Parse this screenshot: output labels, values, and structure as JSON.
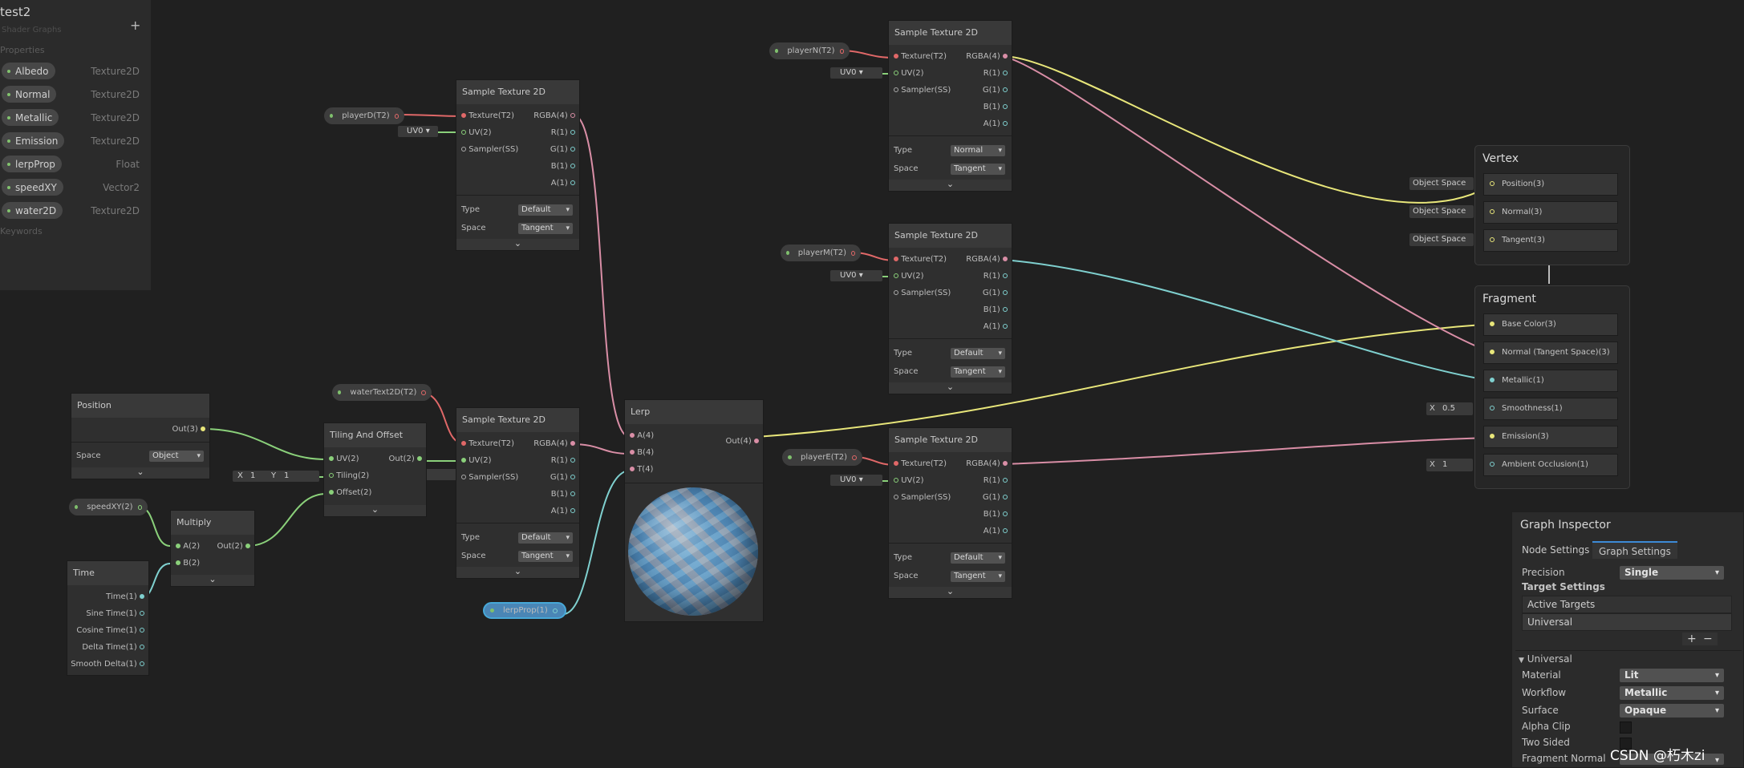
{
  "blackboard": {
    "title": "test2",
    "subtitle": "Shader Graphs",
    "add_glyph": "+",
    "properties_label": "Properties",
    "keywords_label": "Keywords",
    "properties": [
      {
        "name": "Albedo",
        "type": "Texture2D"
      },
      {
        "name": "Normal",
        "type": "Texture2D"
      },
      {
        "name": "Metallic",
        "type": "Texture2D"
      },
      {
        "name": "Emission",
        "type": "Texture2D"
      },
      {
        "name": "lerpProp",
        "type": "Float"
      },
      {
        "name": "speedXY",
        "type": "Vector2"
      },
      {
        "name": "water2D",
        "type": "Texture2D"
      }
    ]
  },
  "sample": {
    "title": "Sample Texture 2D",
    "inputs": [
      "Texture(T2)",
      "UV(2)",
      "Sampler(SS)"
    ],
    "outputs": [
      "RGBA(4)",
      "R(1)",
      "G(1)",
      "B(1)",
      "A(1)"
    ],
    "type_label": "Type",
    "space_label": "Space",
    "space_value": "Tangent",
    "uv_value": "UV0",
    "chevron": "⌄"
  },
  "sample_types": {
    "a": "Default",
    "b": "Default",
    "n": "Normal",
    "m": "Default",
    "e": "Default"
  },
  "pills": {
    "playerD": "playerD(T2)",
    "playerN": "playerN(T2)",
    "playerM": "playerM(T2)",
    "playerE": "playerE(T2)",
    "waterText2D": "waterText2D(T2)",
    "speedXY": "speedXY(2)",
    "lerpProp": "lerpProp(1)"
  },
  "position_node": {
    "title": "Position",
    "output": "Out(3)",
    "space_label": "Space",
    "space_value": "Object"
  },
  "tiling_node": {
    "title": "Tiling And Offset",
    "inputs": [
      "UV(2)",
      "Tiling(2)",
      "Offset(2)"
    ],
    "output": "Out(2)",
    "tiling_x_label": "X",
    "tiling_x": "1",
    "tiling_y_label": "Y",
    "tiling_y": "1"
  },
  "multiply_node": {
    "title": "Multiply",
    "inputs": [
      "A(2)",
      "B(2)"
    ],
    "output": "Out(2)"
  },
  "time_node": {
    "title": "Time",
    "outputs": [
      "Time(1)",
      "Sine Time(1)",
      "Cosine Time(1)",
      "Delta Time(1)",
      "Smooth Delta(1)"
    ]
  },
  "lerp_node": {
    "title": "Lerp",
    "inputs": [
      "A(4)",
      "B(4)",
      "T(4)"
    ],
    "output": "Out(4)"
  },
  "vertex": {
    "title": "Vertex",
    "blocks": [
      "Position(3)",
      "Normal(3)",
      "Tangent(3)"
    ],
    "space_value": "Object Space"
  },
  "fragment": {
    "title": "Fragment",
    "blocks": [
      "Base Color(3)",
      "Normal (Tangent Space)(3)",
      "Metallic(1)",
      "Smoothness(1)",
      "Emission(3)",
      "Ambient Occlusion(1)"
    ],
    "smoothness_label": "X",
    "smoothness_value": "0.5",
    "occlusion_label": "X",
    "occlusion_value": "1"
  },
  "inspector": {
    "title": "Graph Inspector",
    "tab_node": "Node Settings",
    "tab_graph": "Graph Settings",
    "precision_label": "Precision",
    "precision_value": "Single",
    "target_settings": "Target Settings",
    "active_targets": "Active Targets",
    "target_universal": "Universal",
    "add_glyph": "+",
    "remove_glyph": "−",
    "section_universal": "Universal",
    "material_label": "Material",
    "material_value": "Lit",
    "workflow_label": "Workflow",
    "workflow_value": "Metallic",
    "surface_label": "Surface",
    "surface_value": "Opaque",
    "alpha_clip_label": "Alpha Clip",
    "two_sided_label": "Two Sided",
    "fragment_normal_label": "Fragment Normal"
  },
  "watermark": "CSDN @朽木zi",
  "colors": {
    "texture": "#e06868",
    "vector2": "#8ad07a",
    "vector4": "#d98ea6",
    "float": "#7fd0cf",
    "vector3": "#e8e67a"
  }
}
